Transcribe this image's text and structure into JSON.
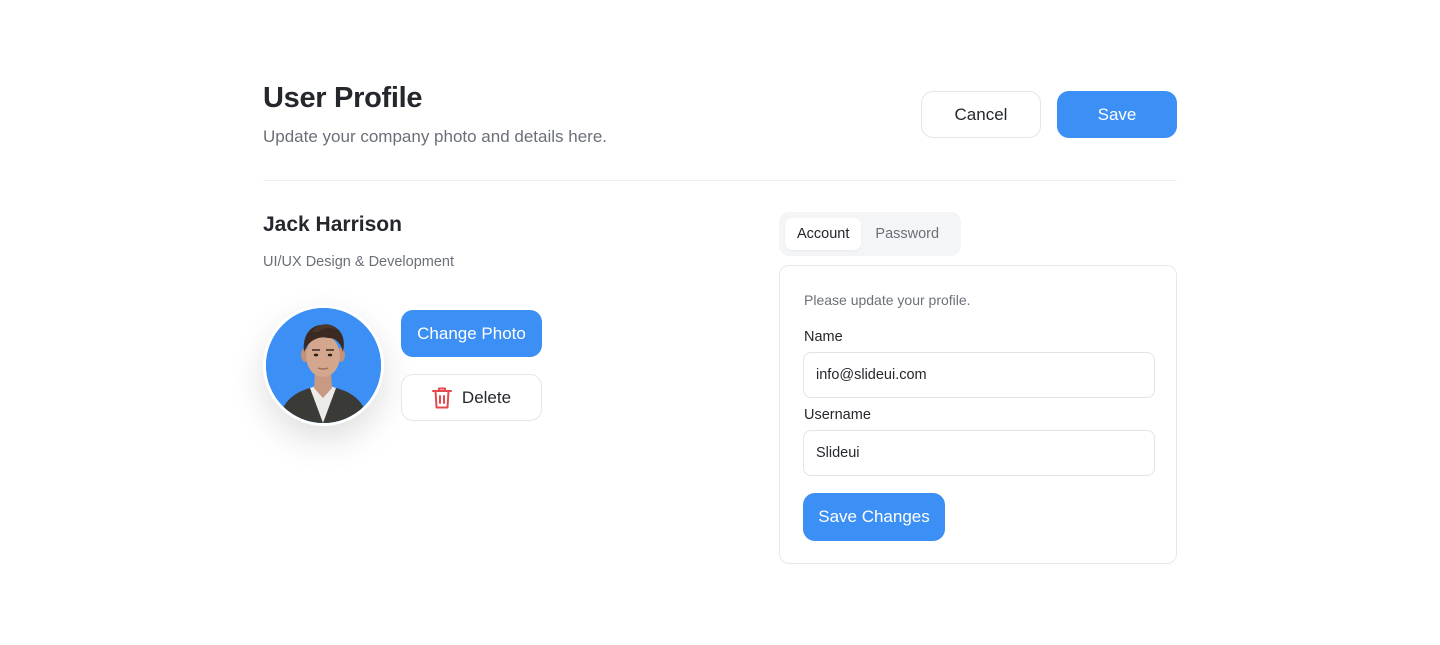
{
  "header": {
    "title": "User Profile",
    "subtitle": "Update your company photo and details here.",
    "cancel_label": "Cancel",
    "save_label": "Save"
  },
  "profile": {
    "name": "Jack Harrison",
    "role": "UI/UX Design & Development",
    "change_photo_label": "Change Photo",
    "delete_label": "Delete",
    "delete_icon": "trash-icon"
  },
  "tabs": [
    {
      "label": "Account",
      "active": true
    },
    {
      "label": "Password",
      "active": false
    }
  ],
  "form": {
    "hint": "Please update your profile.",
    "name_label": "Name",
    "name_value": "info@slideui.com",
    "username_label": "Username",
    "username_value": "Slideui",
    "submit_label": "Save Changes"
  },
  "colors": {
    "accent": "#3b8ff5",
    "danger": "#e5484d"
  }
}
